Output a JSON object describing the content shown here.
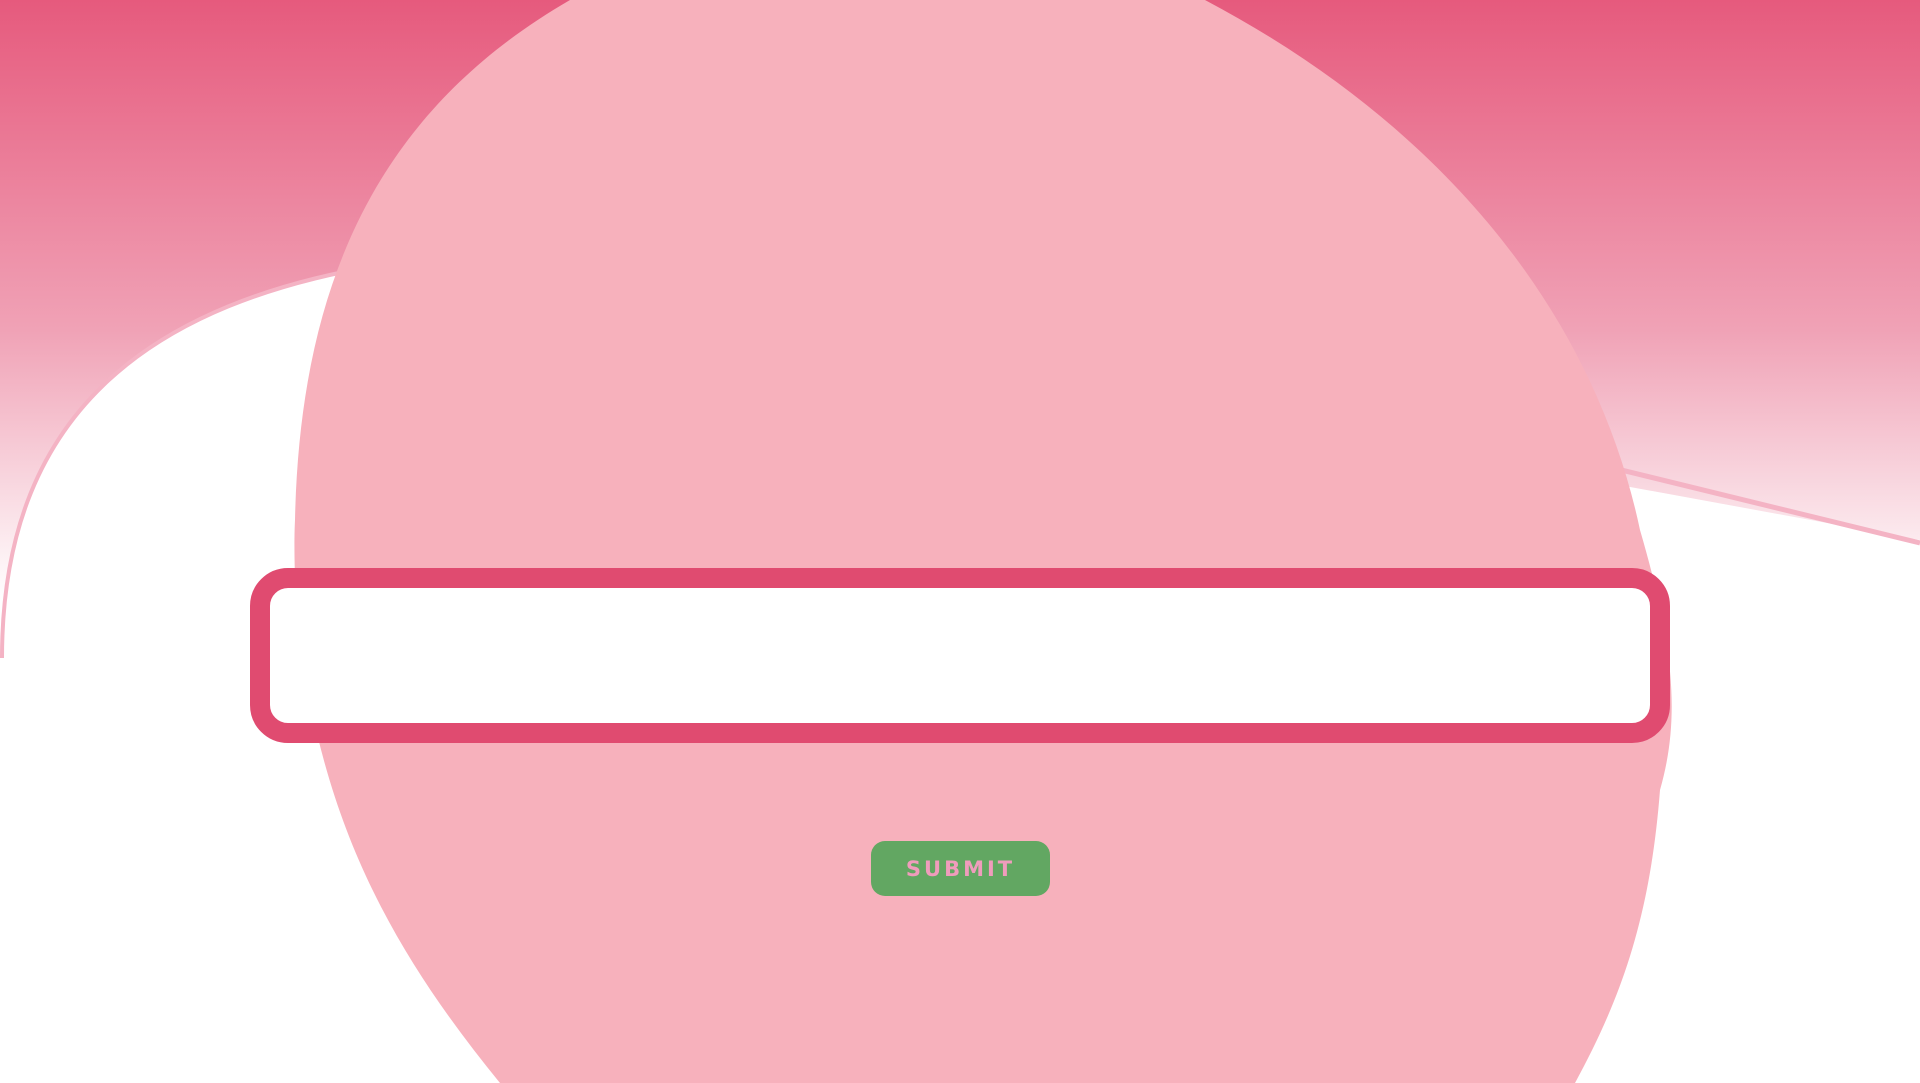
{
  "theme": {
    "header_gradient_top": "#e65a7d",
    "header_gradient_bottom": "#ffffff",
    "blob_color": "#f7b1bc",
    "accent_line_color": "#f4b3c4",
    "input_border_color": "#e04b70",
    "button_background": "#62a762",
    "button_text_color": "#f09cbc"
  },
  "form": {
    "answer_input": {
      "value": "",
      "placeholder": ""
    },
    "submit_label": "SUBMIT"
  }
}
